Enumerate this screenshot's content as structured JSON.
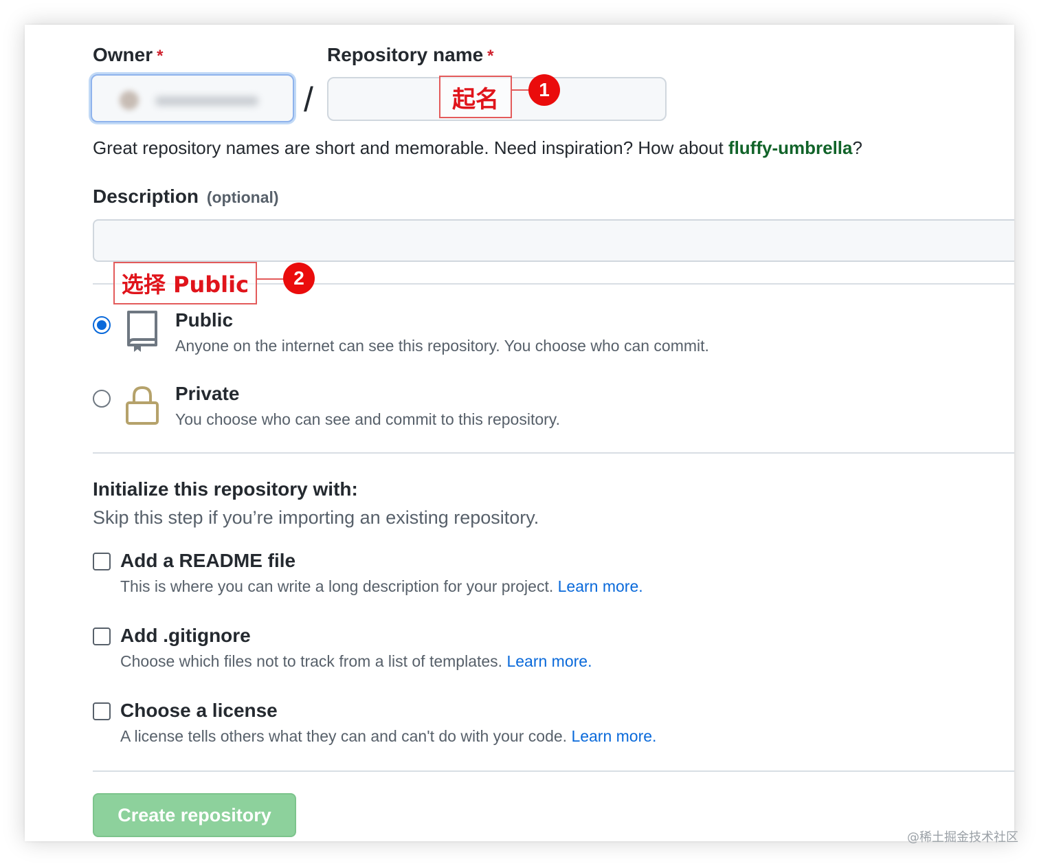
{
  "form": {
    "owner_label": "Owner",
    "required_mark": "*",
    "repo_name_label": "Repository name",
    "slash": "/",
    "repo_name_value": "",
    "name_hint_prefix": "Great repository names are short and memorable. Need inspiration? How about ",
    "name_suggestion": "fluffy-umbrella",
    "name_hint_suffix": "?",
    "description_label": "Description",
    "description_optional": "(optional)",
    "description_value": ""
  },
  "annotations": [
    {
      "text": "起名",
      "badge": "1"
    },
    {
      "text": "选择 Public",
      "badge": "2"
    }
  ],
  "visibility": {
    "selected": "public",
    "options": [
      {
        "title": "Public",
        "description": "Anyone on the internet can see this repository. You choose who can commit.",
        "icon": "repo-icon"
      },
      {
        "title": "Private",
        "description": "You choose who can see and commit to this repository.",
        "icon": "lock-icon"
      }
    ]
  },
  "initialize": {
    "title": "Initialize this repository with:",
    "subtitle": "Skip this step if you’re importing an existing repository.",
    "options": [
      {
        "title": "Add a README file",
        "description": "This is where you can write a long description for your project.",
        "link": "Learn more.",
        "checked": false
      },
      {
        "title": "Add .gitignore",
        "description": "Choose which files not to track from a list of templates.",
        "link": "Learn more.",
        "checked": false
      },
      {
        "title": "Choose a license",
        "description": "A license tells others what they can and can't do with your code.",
        "link": "Learn more.",
        "checked": false
      }
    ]
  },
  "create_button": "Create repository",
  "watermark": "@稀土掘金技术社区",
  "colors": {
    "primary_button_disabled": "#8dd19c",
    "link": "#0969da",
    "annotation_red": "#e0141b",
    "radio_selected": "#0969da"
  }
}
